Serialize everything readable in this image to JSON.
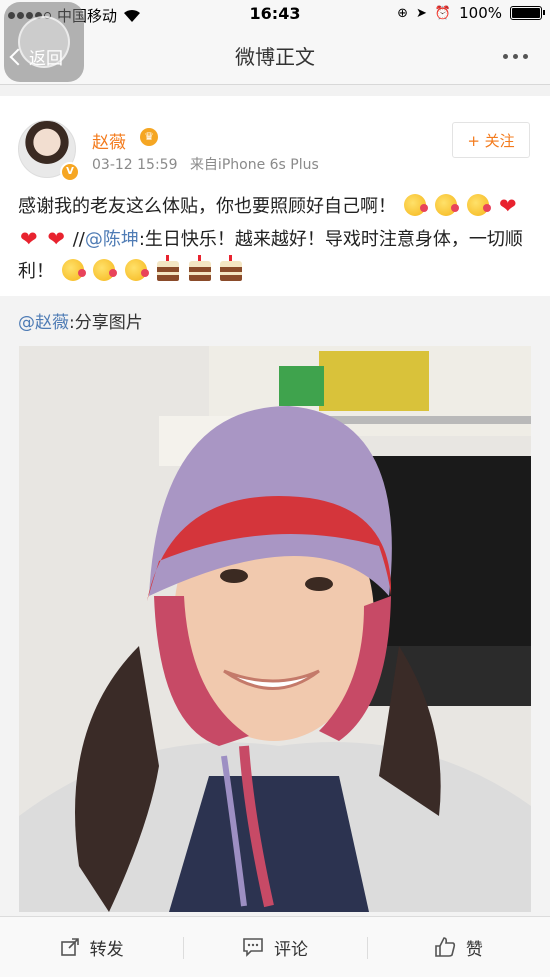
{
  "status_bar": {
    "carrier": "中国移动",
    "time": "16:43",
    "battery": "100%"
  },
  "nav": {
    "back_label": "返回",
    "title": "微博正文"
  },
  "post": {
    "author": "赵薇",
    "timestamp": "03-12 15:59",
    "source": "来自iPhone 6s Plus",
    "follow_label": "+ 关注",
    "text_part1": "感谢我的老友这么体贴，你也要照顾好自己啊！",
    "text_part2": "//",
    "mention": "@陈坤",
    "text_part3": ":生日快乐！越来越好！导戏时注意身体，一切顺利！"
  },
  "repost": {
    "mention": "@赵薇",
    "text": ":分享图片"
  },
  "toolbar": {
    "repost_label": "转发",
    "comment_label": "评论",
    "like_label": "赞"
  },
  "colors": {
    "accent": "#f37b1d",
    "link": "#4f7cb5",
    "heart": "#e8232f"
  }
}
